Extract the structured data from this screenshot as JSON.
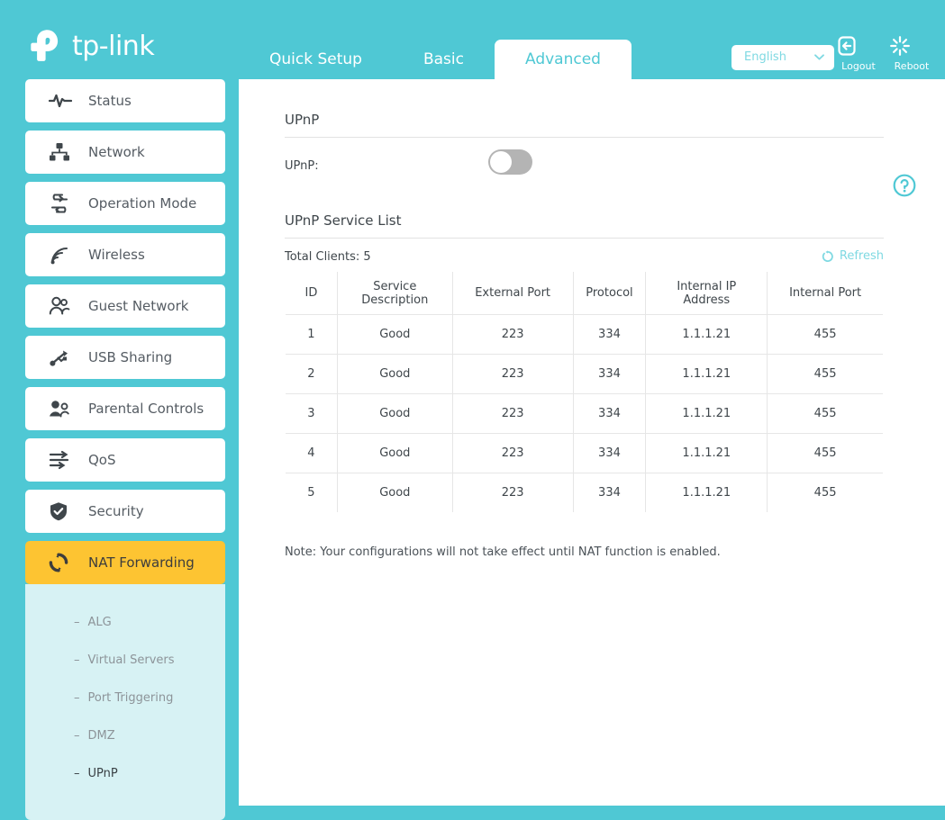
{
  "header": {
    "brand": "tp-link",
    "nav": [
      {
        "label": "Quick Setup",
        "active": false
      },
      {
        "label": "Basic",
        "active": false
      },
      {
        "label": "Advanced",
        "active": true
      }
    ],
    "language": {
      "value": "English",
      "icon": "chevron-down-icon"
    },
    "logout": {
      "label": "Logout",
      "icon": "logout-icon"
    },
    "reboot": {
      "label": "Reboot",
      "icon": "reboot-icon"
    }
  },
  "sidebar": {
    "items": [
      {
        "label": "Status",
        "icon": "pulse-icon",
        "active": false
      },
      {
        "label": "Network",
        "icon": "network-tree-icon",
        "active": false
      },
      {
        "label": "Operation Mode",
        "icon": "swap-arrows-icon",
        "active": false
      },
      {
        "label": "Wireless",
        "icon": "wifi-signal-icon",
        "active": false
      },
      {
        "label": "Guest Network",
        "icon": "people-icon",
        "active": false
      },
      {
        "label": "USB Sharing",
        "icon": "usb-icon",
        "active": false
      },
      {
        "label": "Parental Controls",
        "icon": "parent-child-icon",
        "active": false
      },
      {
        "label": "QoS",
        "icon": "qos-arrows-icon",
        "active": false
      },
      {
        "label": "Security",
        "icon": "shield-check-icon",
        "active": false
      },
      {
        "label": "NAT Forwarding",
        "icon": "nat-refresh-icon",
        "active": true
      }
    ],
    "submenu": [
      {
        "label": "ALG",
        "active": false
      },
      {
        "label": "Virtual Servers",
        "active": false
      },
      {
        "label": "Port Triggering",
        "active": false
      },
      {
        "label": "DMZ",
        "active": false
      },
      {
        "label": "UPnP",
        "active": true
      }
    ],
    "submenu_dash": "–"
  },
  "content": {
    "help_icon": "question-circle-icon",
    "upnp_section": {
      "title": "UPnP",
      "field_label": "UPnP:",
      "toggle_state": "off"
    },
    "service_list": {
      "title": "UPnP Service List",
      "total_clients": "Total Clients: 5",
      "refresh_label": "Refresh",
      "refresh_icon": "refresh-icon",
      "columns": [
        "ID",
        "Service Description",
        "External Port",
        "Protocol",
        "Internal IP Address",
        "Internal Port"
      ],
      "rows": [
        [
          "1",
          "Good",
          "223",
          "334",
          "1.1.1.21",
          "455"
        ],
        [
          "2",
          "Good",
          "223",
          "334",
          "1.1.1.21",
          "455"
        ],
        [
          "3",
          "Good",
          "223",
          "334",
          "1.1.1.21",
          "455"
        ],
        [
          "4",
          "Good",
          "223",
          "334",
          "1.1.1.21",
          "455"
        ],
        [
          "5",
          "Good",
          "223",
          "334",
          "1.1.1.21",
          "455"
        ]
      ]
    },
    "note": "Note: Your configurations will not take effect until NAT function is enabled."
  },
  "colors": {
    "brand_teal": "#4fc8d4",
    "accent_amber": "#fdc432",
    "submenu_bg": "#d7f2f4",
    "link_teal": "#7fd9e2"
  }
}
